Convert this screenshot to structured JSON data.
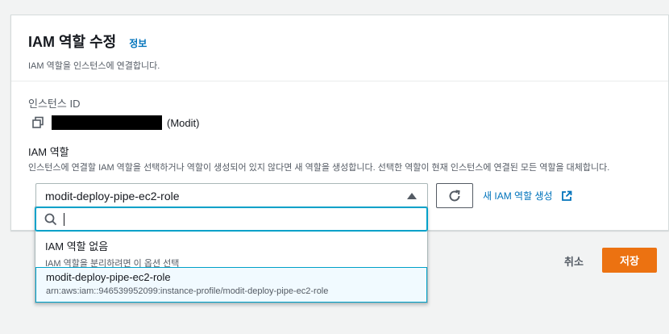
{
  "panel": {
    "title": "IAM 역할 수정",
    "info_link": "정보",
    "subtitle": "IAM 역할을 인스턴스에 연결합니다."
  },
  "instance": {
    "label": "인스턴스 ID",
    "name": "(Modit)",
    "copy_icon": "copy-icon"
  },
  "iam_role": {
    "label": "IAM 역할",
    "description": "인스턴스에 연결할 IAM 역할을 선택하거나 역할이 생성되어 있지 않다면 새 역할을 생성합니다. 선택한 역할이 현재 인스턴스에 연결된 모든 역할을 대체합니다.",
    "selected": "modit-deploy-pipe-ec2-role",
    "new_role_link": "새 IAM 역할 생성"
  },
  "dropdown": {
    "search_value": "",
    "options": [
      {
        "title": "IAM 역할 없음",
        "subtitle": "IAM 역할을 분리하려면 이 옵션 선택"
      },
      {
        "title": "modit-deploy-pipe-ec2-role",
        "subtitle": "arn:aws:iam::946539952099:instance-profile/modit-deploy-pipe-ec2-role"
      }
    ]
  },
  "actions": {
    "cancel": "취소",
    "save": "저장"
  },
  "colors": {
    "link": "#0073bb",
    "primary_button": "#ec7211",
    "focus": "#00a1c9"
  }
}
